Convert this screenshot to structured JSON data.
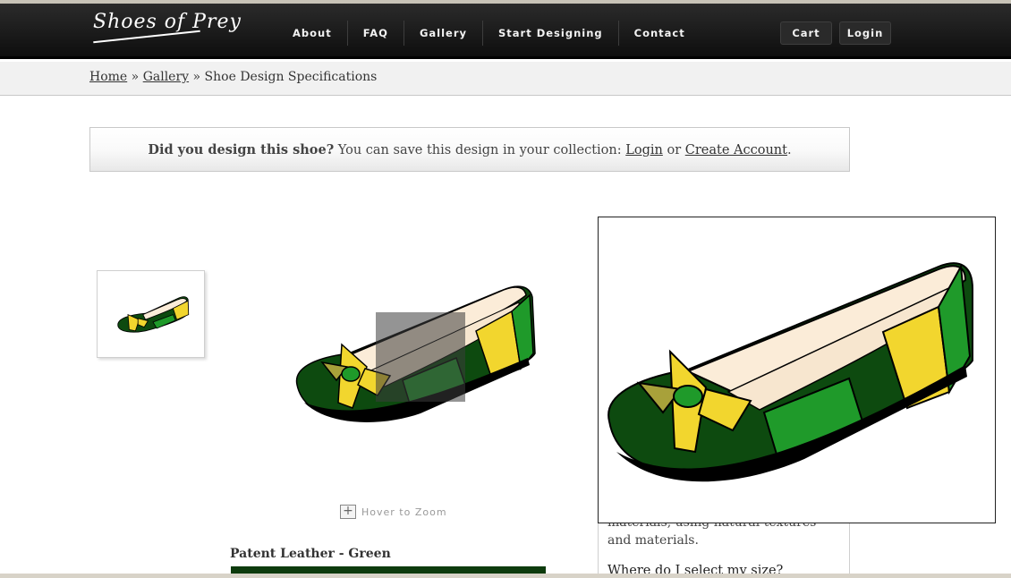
{
  "header": {
    "logo_text": "Shoes of Prey",
    "nav": [
      "About",
      "FAQ",
      "Gallery",
      "Start Designing",
      "Contact"
    ],
    "cart_label": "Cart",
    "login_label": "Login"
  },
  "breadcrumb": {
    "home": "Home",
    "sep1": "»",
    "gallery": "Gallery",
    "sep2": "»",
    "current": "Shoe Design Specifications"
  },
  "notice": {
    "bold": "Did you design this shoe?",
    "text": " You can save this design in your collection: ",
    "login": "Login",
    "or": " or ",
    "create": "Create Account",
    "end": "."
  },
  "viewer": {
    "zoom_hint": "Hover to Zoom",
    "zoom_icon": "plus-icon"
  },
  "material": {
    "label": "Patent Leather - Green",
    "swatch_color": "#0d3b0d"
  },
  "faq": {
    "partial_text": "materials, using natural textures and materials.",
    "question": "Where do I select my size?"
  },
  "colors": {
    "dark_green": "#0d4a0f",
    "bright_green": "#1f9a2a",
    "yellow": "#f2d62e",
    "cream": "#fbecd8"
  }
}
